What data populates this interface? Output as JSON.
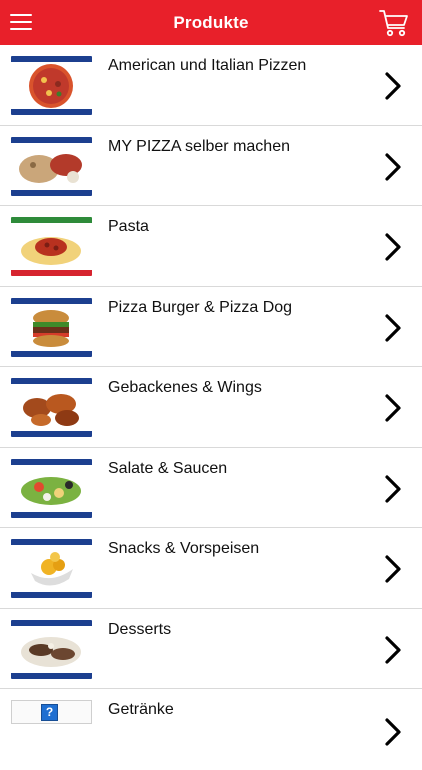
{
  "header": {
    "title": "Produkte",
    "menu_icon": "hamburger-menu-icon",
    "cart_icon": "shopping-cart-icon"
  },
  "colors": {
    "brand_red": "#e8202a",
    "stars_band": "#1c3f8f"
  },
  "categories": [
    {
      "label": "American und Italian Pizzen"
    },
    {
      "label": "MY PIZZA selber machen"
    },
    {
      "label": "Pasta"
    },
    {
      "label": "Pizza Burger & Pizza Dog"
    },
    {
      "label": "Gebackenes & Wings"
    },
    {
      "label": "Salate & Saucen"
    },
    {
      "label": "Snacks & Vorspeisen"
    },
    {
      "label": "Desserts"
    },
    {
      "label": "Getränke"
    }
  ]
}
